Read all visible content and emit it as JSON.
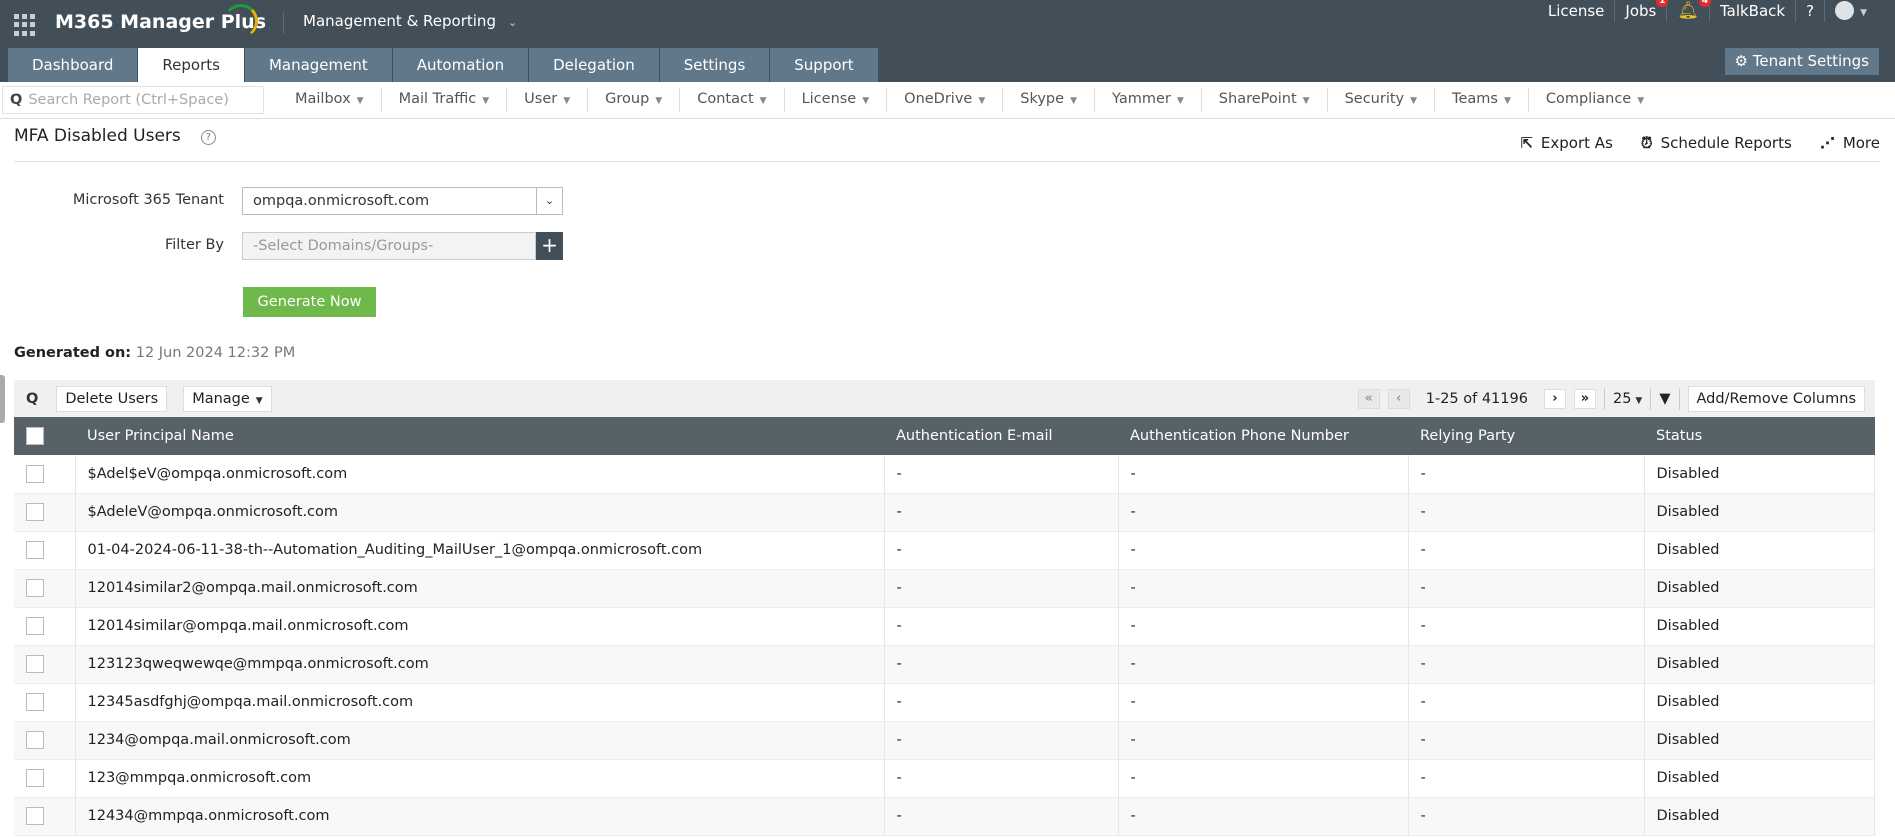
{
  "app": {
    "logo": "M365 Manager Plus",
    "product": "Management & Reporting"
  },
  "toplinks": {
    "license": "License",
    "jobs": "Jobs",
    "jobs_badge": "1",
    "alerts_badge": "4",
    "talkback": "TalkBack",
    "help": "?"
  },
  "tabs": [
    "Dashboard",
    "Reports",
    "Management",
    "Automation",
    "Delegation",
    "Settings",
    "Support"
  ],
  "tenant_settings": "Tenant Settings",
  "search": {
    "placeholder": "Search Report (Ctrl+Space)"
  },
  "nav": [
    "Mailbox",
    "Mail Traffic",
    "User",
    "Group",
    "Contact",
    "License",
    "OneDrive",
    "Skype",
    "Yammer",
    "SharePoint",
    "Security",
    "Teams",
    "Compliance"
  ],
  "page": {
    "title": "MFA Disabled Users",
    "export": "Export As",
    "schedule": "Schedule Reports",
    "more": "More"
  },
  "form": {
    "tenant_label": "Microsoft 365 Tenant",
    "tenant_value": "ompqa.onmicrosoft.com",
    "filter_label": "Filter By",
    "filter_placeholder": "-Select Domains/Groups-",
    "generate": "Generate Now"
  },
  "generated": {
    "label": "Generated on:",
    "value": "12 Jun 2024 12:32 PM"
  },
  "toolbar": {
    "delete": "Delete Users",
    "manage": "Manage",
    "range": "1-25 of 41196",
    "per_page": "25",
    "columns": "Add/Remove Columns"
  },
  "table": {
    "headers": [
      "User Principal Name",
      "Authentication E-mail",
      "Authentication Phone Number",
      "Relying Party",
      "Status"
    ],
    "rows": [
      [
        "$Adel$eV@ompqa.onmicrosoft.com",
        "-",
        "-",
        "-",
        "Disabled"
      ],
      [
        "$AdeleV@ompqa.onmicrosoft.com",
        "-",
        "-",
        "-",
        "Disabled"
      ],
      [
        "01-04-2024-06-11-38-th--Automation_Auditing_MailUser_1@ompqa.onmicrosoft.com",
        "-",
        "-",
        "-",
        "Disabled"
      ],
      [
        "12014similar2@ompqa.mail.onmicrosoft.com",
        "-",
        "-",
        "-",
        "Disabled"
      ],
      [
        "12014similar@ompqa.mail.onmicrosoft.com",
        "-",
        "-",
        "-",
        "Disabled"
      ],
      [
        "123123qweqwewqe@mmpqa.onmicrosoft.com",
        "-",
        "-",
        "-",
        "Disabled"
      ],
      [
        "12345asdfghj@ompqa.mail.onmicrosoft.com",
        "-",
        "-",
        "-",
        "Disabled"
      ],
      [
        "1234@ompqa.mail.onmicrosoft.com",
        "-",
        "-",
        "-",
        "Disabled"
      ],
      [
        "123@mmpqa.onmicrosoft.com",
        "-",
        "-",
        "-",
        "Disabled"
      ],
      [
        "12434@mmpqa.onmicrosoft.com",
        "-",
        "-",
        "-",
        "Disabled"
      ]
    ]
  }
}
